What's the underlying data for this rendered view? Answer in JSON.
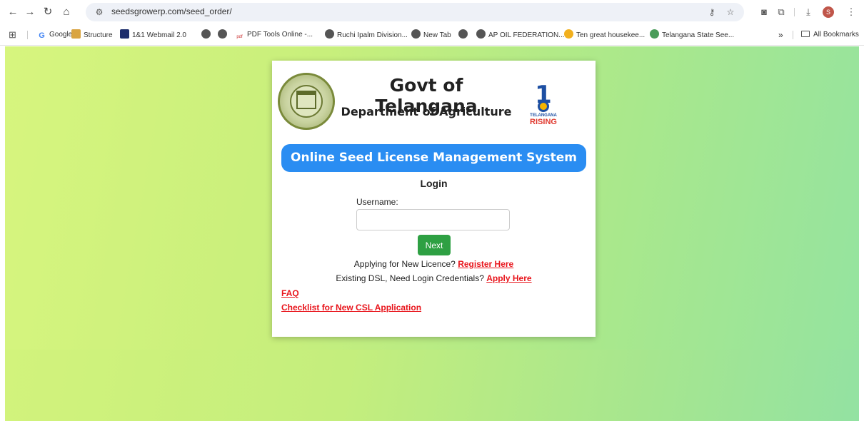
{
  "browser": {
    "url": "seedsgrowerp.com/seed_order/",
    "icons": {
      "back": "back-arrow-icon",
      "forward": "forward-arrow-icon",
      "reload": "reload-icon",
      "home": "home-icon",
      "site_info": "site-info-icon",
      "password_key": "password-key-icon",
      "bookmark_star": "star-icon",
      "screenshot": "camera-icon",
      "extensions": "extensions-icon",
      "download": "download-icon",
      "menu": "kebab-menu-icon"
    },
    "avatar_letter": "S",
    "bookmarks": [
      {
        "label": "Google",
        "icon": "google-icon"
      },
      {
        "label": "Structure",
        "icon": "structure-icon"
      },
      {
        "label": "1&1 Webmail 2.0",
        "icon": "webmail-icon"
      },
      {
        "label": "",
        "icon": "globe-icon"
      },
      {
        "label": "",
        "icon": "globe-icon"
      },
      {
        "label": "PDF Tools Online -...",
        "icon": "pdf-icon"
      },
      {
        "label": "Ruchi Ipalm Division...",
        "icon": "globe-icon"
      },
      {
        "label": "New Tab",
        "icon": "globe-icon"
      },
      {
        "label": "",
        "icon": "globe-icon"
      },
      {
        "label": "AP OIL FEDERATION...",
        "icon": "globe-icon"
      },
      {
        "label": "Ten great housekee...",
        "icon": "coin-icon"
      },
      {
        "label": "Telangana State See...",
        "icon": "telangana-icon"
      }
    ],
    "bookmarks_overflow": "»",
    "all_bookmarks": "All Bookmarks"
  },
  "header": {
    "title": "Govt of Telangana",
    "subtitle": "Department of Agriculture",
    "rising_logo_top": "TELANGANA",
    "rising_logo_bottom": "RISING",
    "rising_logo_numeral": "1"
  },
  "system_name": "Online Seed License Management System",
  "login": {
    "heading": "Login",
    "username_label": "Username:",
    "username_value": "",
    "username_placeholder": "",
    "next_button": "Next"
  },
  "links": {
    "new_licence_prefix": "Applying for New Licence?",
    "register_here": "Register Here",
    "existing_prefix": "Existing DSL, Need Login Credentials?",
    "apply_here": "Apply Here",
    "faq": "FAQ",
    "checklist": "Checklist for New CSL Application"
  },
  "colors": {
    "banner": "#2a8df2",
    "next_button": "#2ea043",
    "link_red": "#e8141b",
    "background_left": "#d7f57e",
    "background_right": "#94e3a0"
  }
}
